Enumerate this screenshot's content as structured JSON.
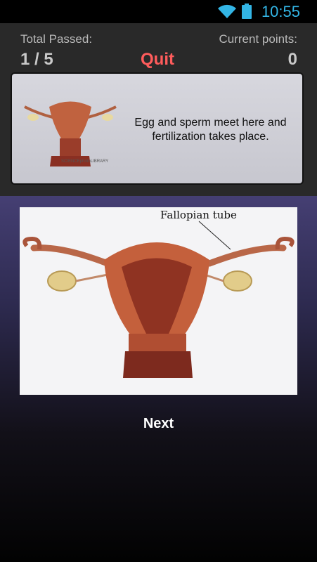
{
  "status_bar": {
    "time": "10:55",
    "icons": [
      "wifi-icon",
      "battery-icon"
    ],
    "accent_color": "#33b5e5"
  },
  "header": {
    "total_passed_label": "Total Passed:",
    "total_passed_value": "1 / 5",
    "quit_label": "Quit",
    "current_points_label": "Current points:",
    "current_points_value": "0",
    "quit_color": "#ff5c5c"
  },
  "question": {
    "text": "Egg and sperm meet here and fertilization takes place.",
    "thumbnail_caption": "SCIENCEphotoLIBRARY"
  },
  "diagram": {
    "label": "Fallopian tube"
  },
  "footer": {
    "next_label": "Next"
  }
}
